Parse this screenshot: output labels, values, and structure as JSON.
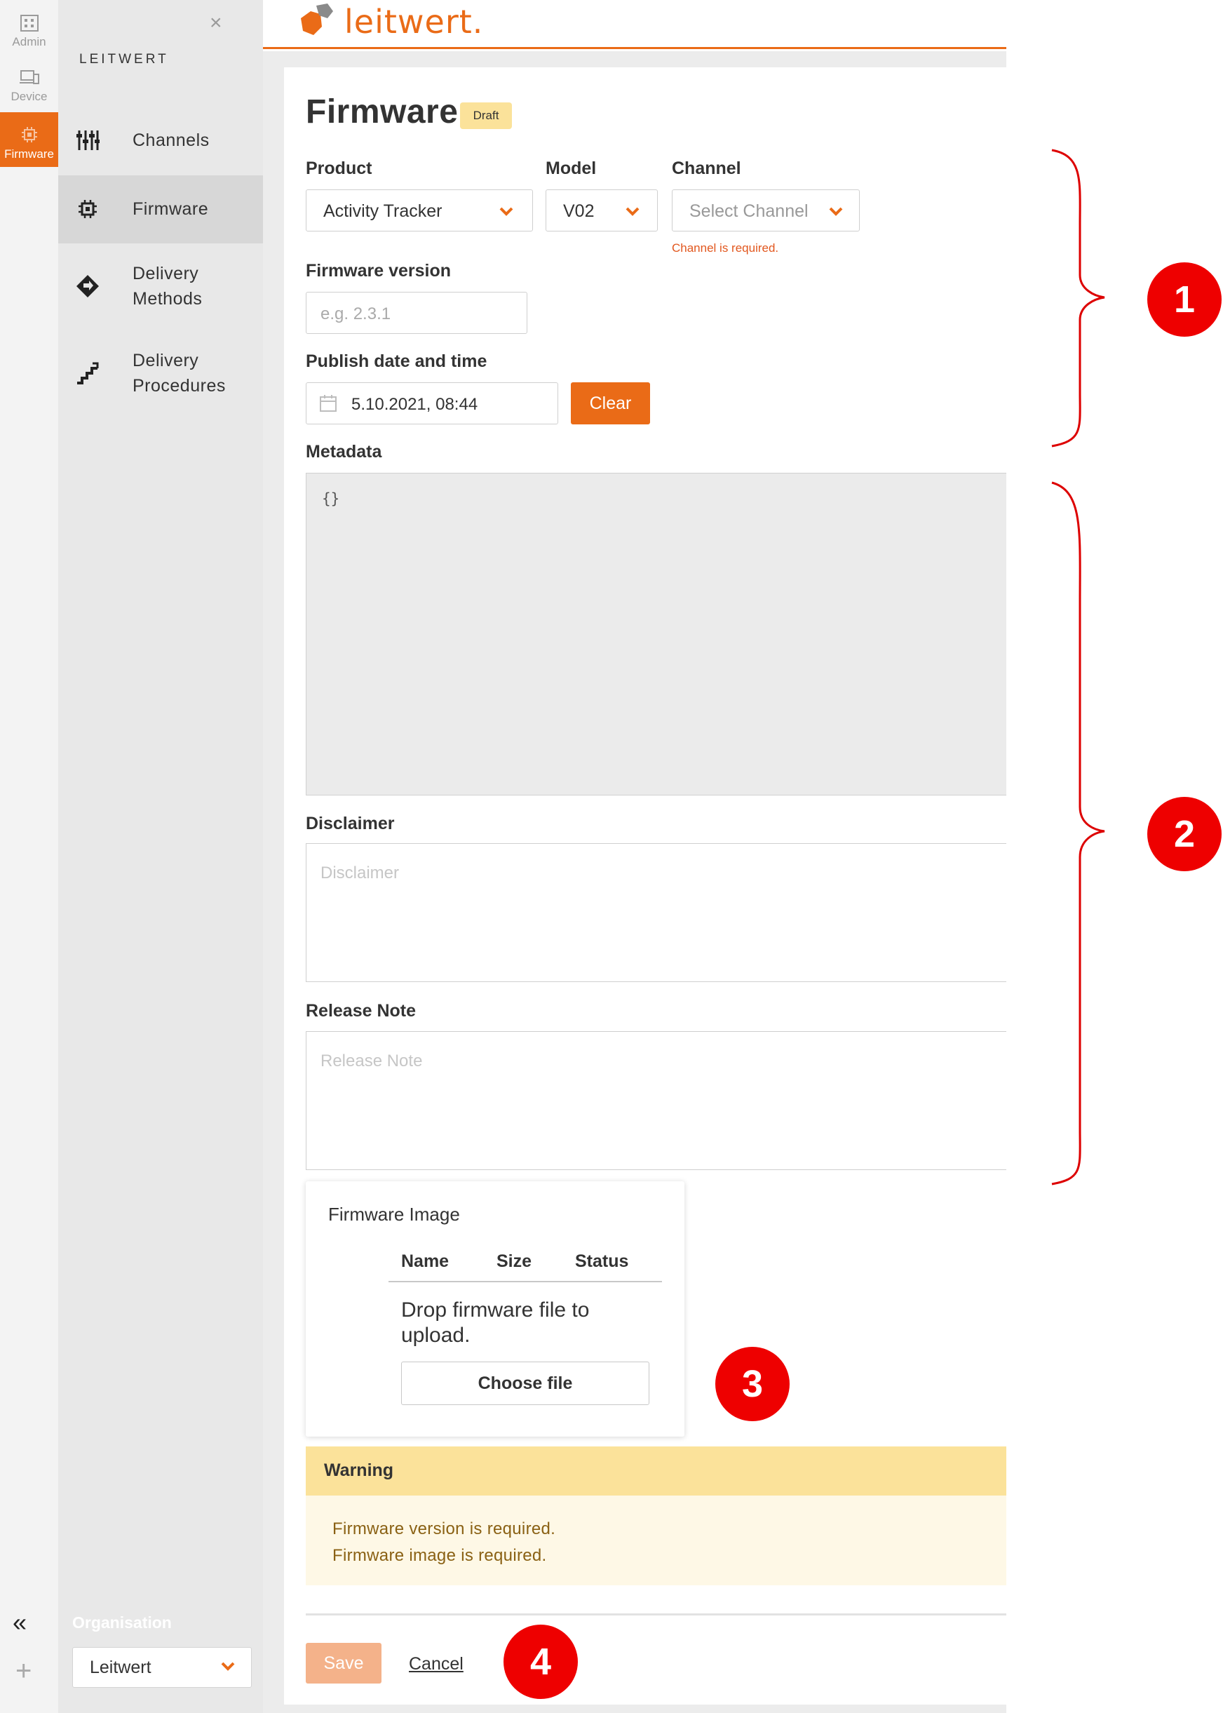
{
  "rail": {
    "items": [
      {
        "label": "Admin",
        "icon": "building-icon"
      },
      {
        "label": "Device",
        "icon": "devices-icon"
      },
      {
        "label": "Firmware",
        "icon": "chip-icon",
        "active": true
      }
    ],
    "collapse_glyph": "«",
    "add_glyph": "+"
  },
  "sidebar": {
    "close_glyph": "×",
    "title": "LEITWERT",
    "items": [
      {
        "line1": "Channels",
        "line2": "",
        "icon": "channels-icon"
      },
      {
        "line1": "Firmware",
        "line2": "",
        "icon": "chip-icon",
        "active": true
      },
      {
        "line1": "Delivery",
        "line2": "Methods",
        "icon": "direction-diamond-icon"
      },
      {
        "line1": "Delivery",
        "line2": "Procedures",
        "icon": "stairs-icon"
      }
    ],
    "organisation": {
      "label": "Organisation",
      "value": "Leitwert"
    }
  },
  "header": {
    "logo_text": "leitwert."
  },
  "form": {
    "title": "Firmware",
    "status_badge": "Draft",
    "product": {
      "label": "Product",
      "value": "Activity Tracker"
    },
    "model": {
      "label": "Model",
      "value": "V02"
    },
    "channel": {
      "label": "Channel",
      "placeholder": "Select Channel",
      "error": "Channel is required."
    },
    "firmware_version": {
      "label": "Firmware version",
      "placeholder": "e.g. 2.3.1"
    },
    "publish": {
      "label": "Publish date and time",
      "value": "5.10.2021, 08:44",
      "clear_label": "Clear"
    },
    "metadata": {
      "label": "Metadata",
      "value": "{}"
    },
    "disclaimer": {
      "label": "Disclaimer",
      "placeholder": "Disclaimer"
    },
    "release_note": {
      "label": "Release Note",
      "placeholder": "Release Note"
    }
  },
  "firmware_image": {
    "title": "Firmware Image",
    "columns": [
      "Name",
      "Size",
      "Status"
    ],
    "drop_text": "Drop firmware file to upload.",
    "choose_label": "Choose file"
  },
  "warning": {
    "title": "Warning",
    "messages": [
      "Firmware version is required.",
      "Firmware image is required."
    ]
  },
  "actions": {
    "save_label": "Save",
    "cancel_label": "Cancel"
  },
  "annotations": {
    "callouts": [
      "1",
      "2",
      "3",
      "4"
    ],
    "color": "#ee0000"
  },
  "colors": {
    "accent": "#ea6b17",
    "warning_bg": "#fbe29a",
    "error": "#e2571e"
  }
}
